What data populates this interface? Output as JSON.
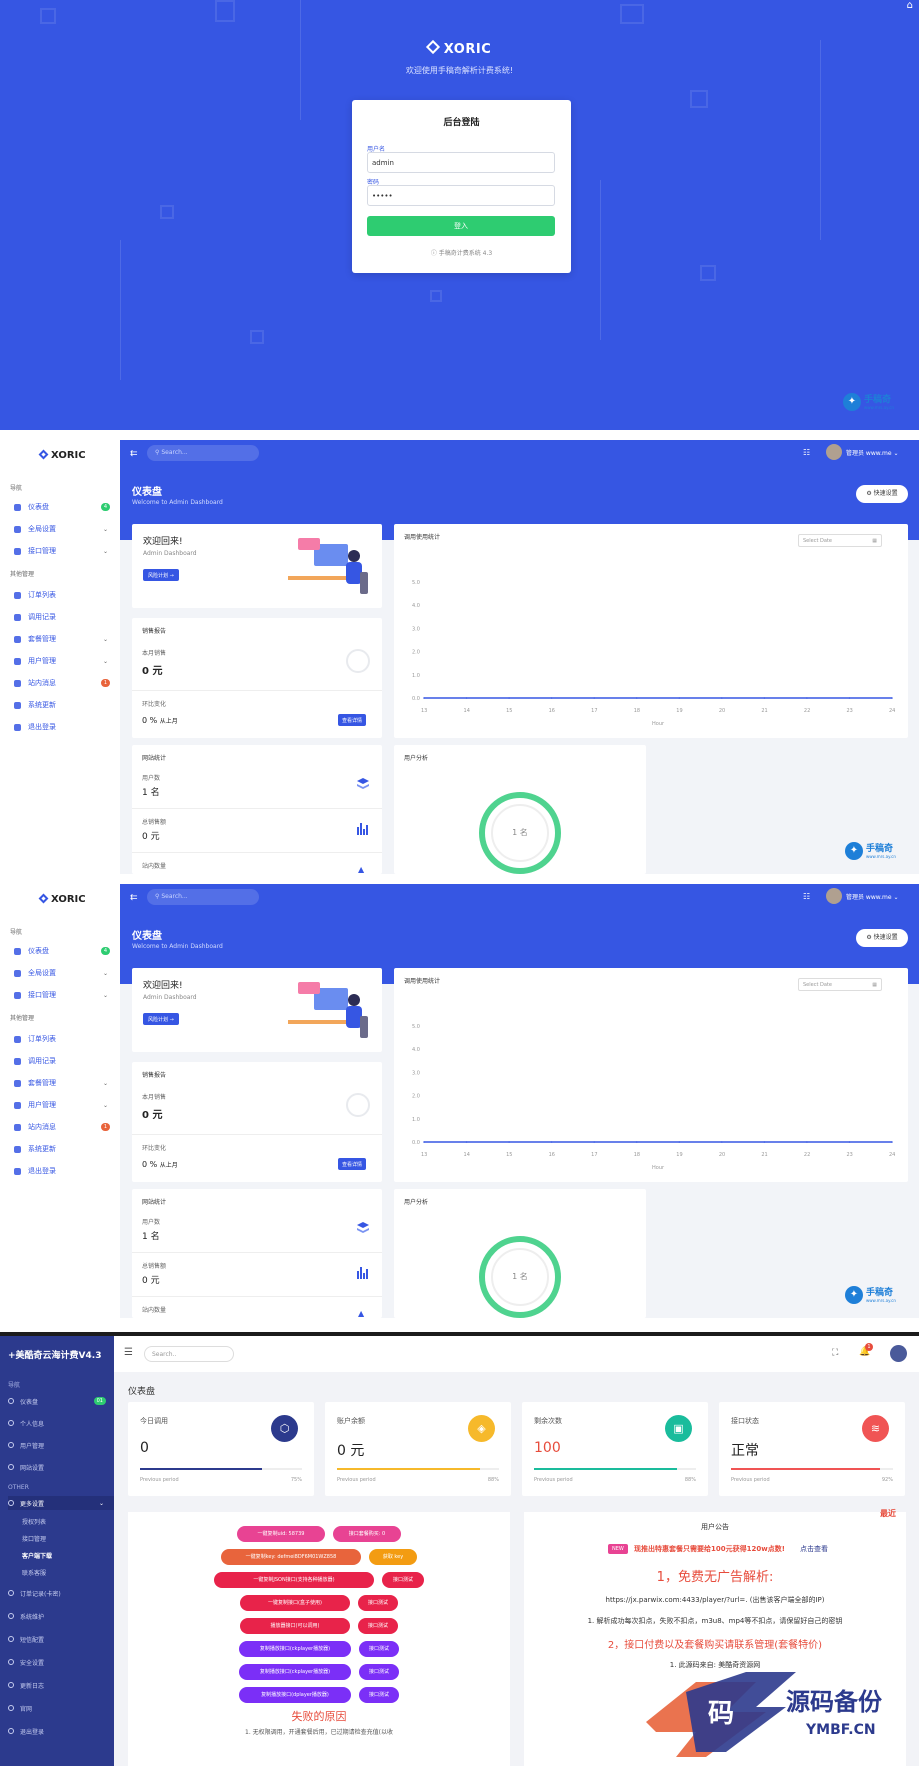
{
  "login": {
    "brand": "XORIC",
    "welcome": "欢迎使用手稿奇解析计费系统!",
    "title": "后台登陆",
    "username_label": "用户名",
    "username_value": "admin",
    "password_label": "密码",
    "password_value": "•••••",
    "submit": "登入",
    "version": "手稿奇计费系统 4.3",
    "watermark_name": "手稿奇",
    "watermark_url": "www.mrs.ay.cn",
    "colors": {
      "primary": "#3656e3",
      "submit": "#2ecc71"
    }
  },
  "dash": {
    "brand": "XORIC",
    "sidebar_group1": "导航",
    "sidebar_group2": "其他管理",
    "sidebar": [
      {
        "label": "仪表盘",
        "icon": "dashboard-icon",
        "badge": "4",
        "badge_color": "#2ecc71"
      },
      {
        "label": "全局设置",
        "icon": "settings-icon",
        "arrow": "⌄"
      },
      {
        "label": "接口管理",
        "icon": "api-icon",
        "arrow": "⌄"
      },
      {
        "label": "订单列表",
        "icon": "order-icon"
      },
      {
        "label": "调用记录",
        "icon": "log-icon"
      },
      {
        "label": "套餐管理",
        "icon": "package-icon",
        "arrow": "⌄"
      },
      {
        "label": "用户管理",
        "icon": "user-icon",
        "arrow": "⌄"
      },
      {
        "label": "站内消息",
        "icon": "message-icon",
        "badge": "1",
        "badge_color": "#e8643c"
      },
      {
        "label": "系统更新",
        "icon": "update-icon"
      },
      {
        "label": "退出登录",
        "icon": "logout-icon"
      }
    ],
    "search_placeholder": "Search...",
    "user1": "管理员 www.me",
    "user2": "管理员 www.me",
    "page_title": "仪表盘",
    "page_subtitle": "Welcome to Admin Dashboard",
    "quick_settings": "快速设置",
    "welcome_title": "欢迎回来!",
    "welcome_sub": "Admin Dashboard",
    "welcome_btn": "风险计划 →",
    "sales_title": "销售报告",
    "sales_month_label": "本月销售",
    "sales_month_value": "0 元",
    "sales_change_label": "环比变化",
    "sales_change_value": "0 %",
    "sales_change_suffix": "从上月",
    "sales_btn": "查看详情",
    "usage_title": "调用使用统计",
    "date_placeholder": "Select Date",
    "site_title": "网站统计",
    "site_users_label": "用户数",
    "site_users_value": "1 名",
    "site_orders_label": "总销售额",
    "site_orders_value": "0 元",
    "site_third_label": "站内数量",
    "user_analysis_title": "用户分析",
    "user_donut_value": "1 名"
  },
  "chart_data": {
    "type": "line",
    "title": "调用使用统计",
    "xlabel": "Hour",
    "x": [
      "13",
      "14",
      "15",
      "16",
      "17",
      "18",
      "19",
      "20",
      "21",
      "22",
      "23",
      "24"
    ],
    "yticks": [
      "5.0",
      "4.0",
      "3.0",
      "2.0",
      "1.0",
      "0.0"
    ],
    "ylim": [
      0,
      5
    ],
    "series": [
      {
        "values": [
          0,
          0,
          0,
          0,
          0,
          0,
          0,
          0,
          0,
          0,
          0,
          0
        ],
        "color": "#3656e3"
      }
    ],
    "grid": false
  },
  "admin": {
    "brand": "+美酷奇云海计费V4.3",
    "group_nav": "导航",
    "group_other": "OTHER",
    "nav": [
      {
        "label": "仪表盘",
        "badge": "01"
      },
      {
        "label": "个人信息"
      },
      {
        "label": "用户管理"
      },
      {
        "label": "网站设置"
      }
    ],
    "active": "更多设置",
    "sub_items": [
      "授权列表",
      "接口管理",
      "客户端下载",
      "联系客服"
    ],
    "more_items": [
      "订单记录(卡密)",
      "系统维护",
      "短信配置",
      "安全设置",
      "更新日志",
      "官网",
      "退出登录"
    ],
    "search": "Search..",
    "bell_count": "1",
    "page_title": "仪表盘",
    "stats": [
      {
        "name": "今日调用",
        "value": "0",
        "pct": "75%",
        "fill": 0.75,
        "color": "#2c3a8d",
        "icon": "cube-icon",
        "glyph": "⬡"
      },
      {
        "name": "账户余额",
        "value": "0 元",
        "pct": "88%",
        "fill": 0.88,
        "color": "#f6b92b",
        "icon": "tag-icon",
        "glyph": "◈"
      },
      {
        "name": "剩余次数",
        "value": "100",
        "value_color": "#e74c3c",
        "pct": "88%",
        "fill": 0.88,
        "color": "#1abc9c",
        "icon": "bag-icon",
        "glyph": "▣"
      },
      {
        "name": "接口状态",
        "value": "正常",
        "pct": "92%",
        "fill": 0.92,
        "color": "#f05454",
        "icon": "layers-icon",
        "glyph": "≋"
      }
    ],
    "period_label": "Previous period",
    "pills": [
      {
        "text": "一键复制uid: 58739",
        "color": "#e84393"
      },
      {
        "text": "接口套餐购买: 0",
        "color": "#e84393"
      },
      {
        "text": "一键复制key: defmei8DF6M01WZ858",
        "color": "#e8643c"
      },
      {
        "text": "获取 key",
        "color": "#f39c12"
      },
      {
        "text": "一键复制JSON接口(支持各种播放器)",
        "color": "#e8234a"
      },
      {
        "text": "接口测试",
        "color": "#e8234a"
      },
      {
        "text": "一键复制接口(盒子使用)",
        "color": "#e8234a"
      },
      {
        "text": "接口测试",
        "color": "#e8234a"
      },
      {
        "text": "播放器接口(可以调用)",
        "color": "#e8234a"
      },
      {
        "text": "接口测试",
        "color": "#e8234a"
      },
      {
        "text": "复制播放接口(ckplayer播放器)",
        "color": "#7b2ff7"
      },
      {
        "text": "接口测试",
        "color": "#7b2ff7"
      },
      {
        "text": "复制播放接口(ckplayer播放器)",
        "color": "#7b2ff7"
      },
      {
        "text": "接口测试",
        "color": "#7b2ff7"
      },
      {
        "text": "复制播放接口(dplayer播放器)",
        "color": "#7b2ff7"
      },
      {
        "text": "接口测试",
        "color": "#7b2ff7"
      }
    ],
    "fail_title": "失败的原因",
    "fail_text": "1. 无权限调用，开通套餐后用，已过期请检查充值(以收",
    "notice_title": "用户公告",
    "notice_new": "NEW",
    "notice_headline": "现推出特惠套餐只需要给100元获得120w点数!",
    "notice_link": "点击查看",
    "notice_h1": "1，免费无广告解析:",
    "notice_url": "https://jx.parwix.com:4433/player/?url=. (出售该客户端全部的IP)",
    "notice_p1": "1. 解析成功每次扣点，失败不扣点，m3u8、mp4等不扣点，请保留好自己的密钥",
    "notice_h2": "2，接口付费以及套餐购买请联系管理(套餐特价)",
    "notice_p2": "1. 此源码来自: 美酷奇资源网",
    "recent": "最近",
    "ymbf_cn": "源码备份",
    "ymbf_en": "YMBF.CN",
    "ymbf_mark": "码"
  }
}
